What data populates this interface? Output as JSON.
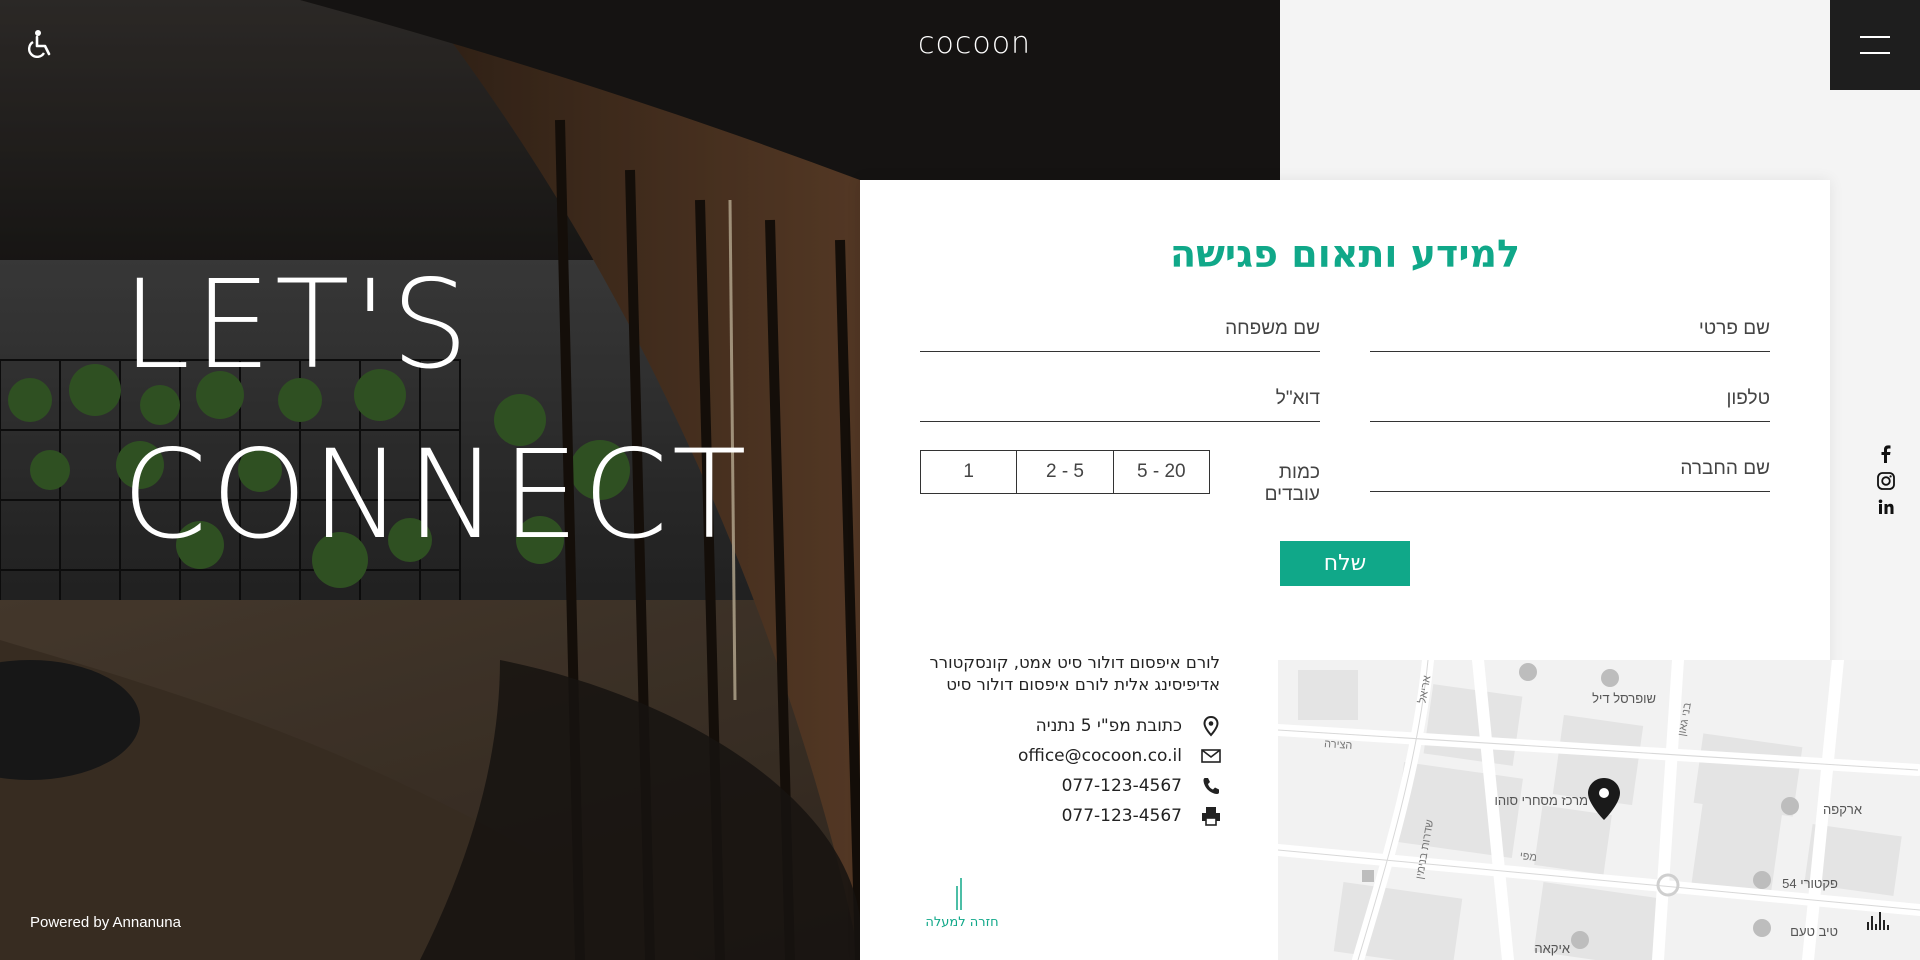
{
  "header": {
    "logo_text": "cocoon",
    "accessibility_icon": "accessibility-icon",
    "menu_icon": "hamburger-menu-icon"
  },
  "hero": {
    "line1": "LET'S",
    "line2": "CONNECT"
  },
  "footer": {
    "powered_by": "Powered by Annanuna"
  },
  "form": {
    "title": "למידע ותאום פגישה",
    "first_name_placeholder": "שם פרטי",
    "last_name_placeholder": "שם משפחה",
    "phone_placeholder": "טלפון",
    "email_placeholder": "דוא\"ל",
    "company_placeholder": "שם החברה",
    "employees_label": "כמות עובדים",
    "employee_options": [
      "1",
      "2 - 5",
      "5 - 20"
    ],
    "submit_label": "שלח"
  },
  "contact": {
    "about": "לורם איפסום דולור סיט אמט, קונסקטורר אדיפיסינג אלית לורם איפסום דולור סיט",
    "address": "כתובת מפ\"י 5 נתניה",
    "email": "office@cocoon.co.il",
    "phone": "077-123-4567",
    "fax": "077-123-4567"
  },
  "back_to_top": {
    "label": "חזרה למעלה"
  },
  "map": {
    "labels": {
      "supersal": "שופרסל דיל",
      "mall": "מרכז מסחרי סוהו",
      "arcafe": "ארקפה",
      "factory": "פקטורי 54",
      "tivtaam": "טיב טעם",
      "ikea": "איקאה",
      "street_hatzira": "הצירה",
      "street_benavraham": "שדרות בנימין",
      "street_mafi": "מפי",
      "street_beniyehuda": "בני גאון",
      "street_ariel": "אריאל"
    }
  },
  "social": {
    "facebook_icon": "facebook-icon",
    "instagram_icon": "instagram-icon",
    "linkedin_icon": "linkedin-icon"
  },
  "colors": {
    "accent": "#10a889",
    "dark": "#1e1e1e"
  }
}
